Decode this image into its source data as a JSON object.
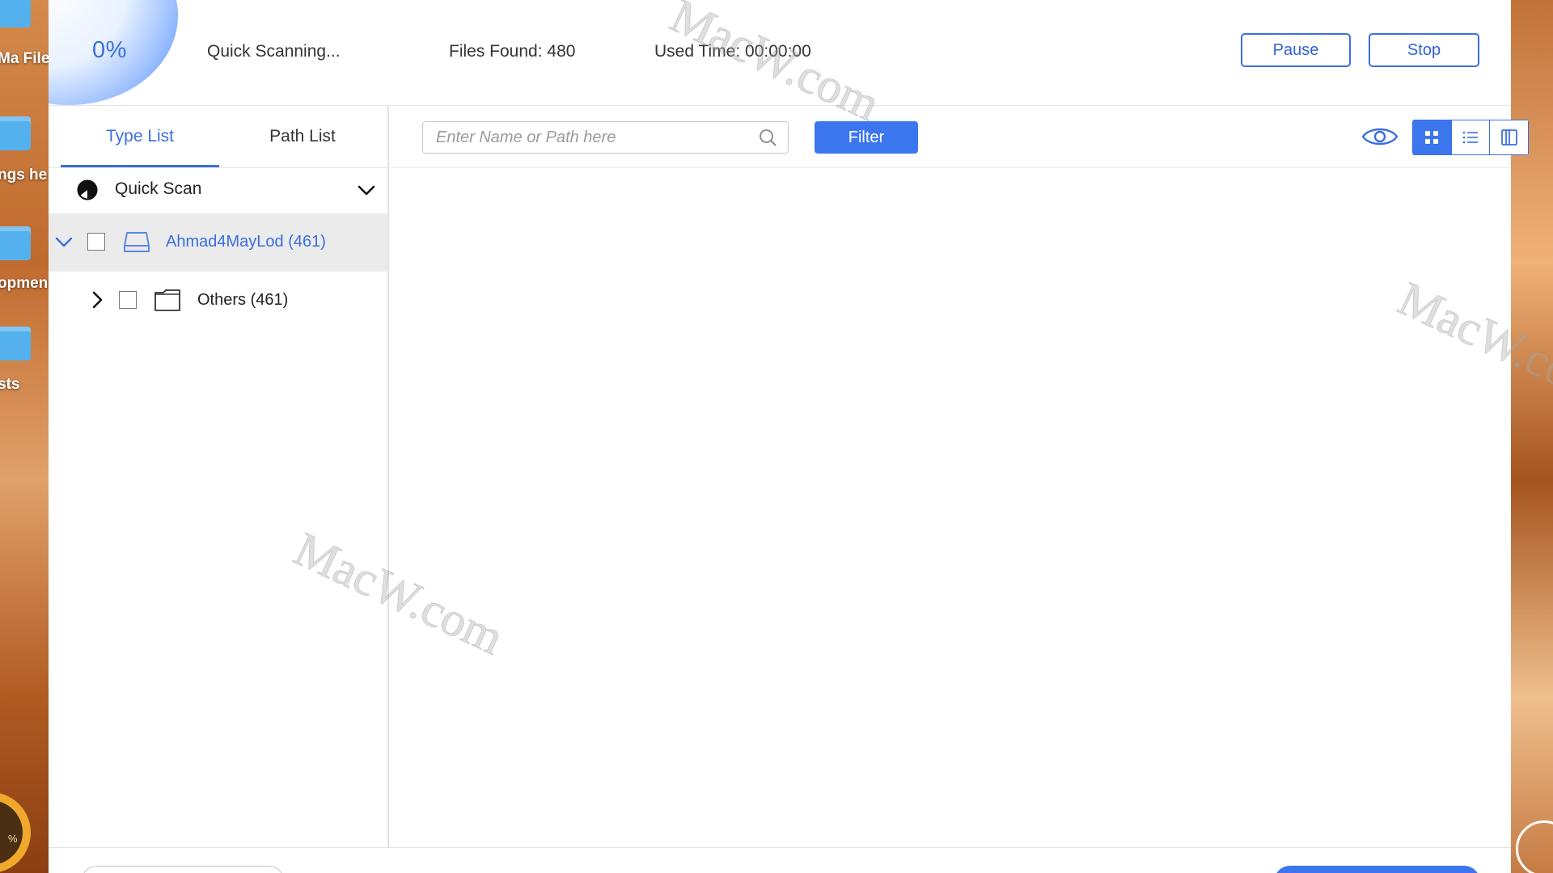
{
  "desktop": {
    "icon_labels": [
      "Ma File",
      "ngs he",
      "opmen",
      "sts"
    ],
    "progress_ring": "%"
  },
  "header": {
    "progress": "0%",
    "status": "Quick Scanning...",
    "files_found": "Files Found: 480",
    "used_time": "Used Time: 00:00:00",
    "pause_label": "Pause",
    "stop_label": "Stop"
  },
  "sidebar": {
    "tabs": [
      {
        "label": "Type List",
        "active": true
      },
      {
        "label": "Path List",
        "active": false
      }
    ],
    "scan_mode": "Quick Scan",
    "tree": [
      {
        "label": "Ahmad4MayLod (461)",
        "expanded": true,
        "selected": true,
        "icon": "drive-icon"
      },
      {
        "label": "Others (461)",
        "expanded": false,
        "selected": false,
        "icon": "folder-icon"
      }
    ]
  },
  "toolbar": {
    "search_placeholder": "Enter Name or Path here",
    "search_value": "",
    "filter_label": "Filter",
    "view_mode": "grid",
    "view_modes": [
      "grid",
      "list",
      "column"
    ]
  },
  "watermark": "MacW.com",
  "colors": {
    "accent": "#3b76ee",
    "accent_text": "#3a6fe0",
    "selected_row": "#ebebeb"
  }
}
